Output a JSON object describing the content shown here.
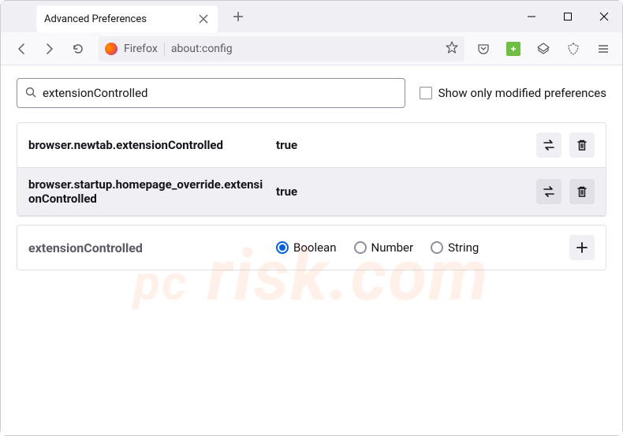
{
  "window": {
    "tab_title": "Advanced Preferences"
  },
  "urlbar": {
    "context": "Firefox",
    "url": "about:config"
  },
  "search": {
    "value": "extensionControlled",
    "checkbox_label": "Show only modified preferences"
  },
  "prefs": [
    {
      "name": "browser.newtab.extensionControlled",
      "value": "true"
    },
    {
      "name": "browser.startup.homepage_override.extensionControlled",
      "value": "true"
    }
  ],
  "new_pref": {
    "name": "extensionControlled",
    "types": [
      "Boolean",
      "Number",
      "String"
    ],
    "selected": "Boolean"
  },
  "watermark": {
    "text1": "pc",
    "text2": "risk.com"
  }
}
